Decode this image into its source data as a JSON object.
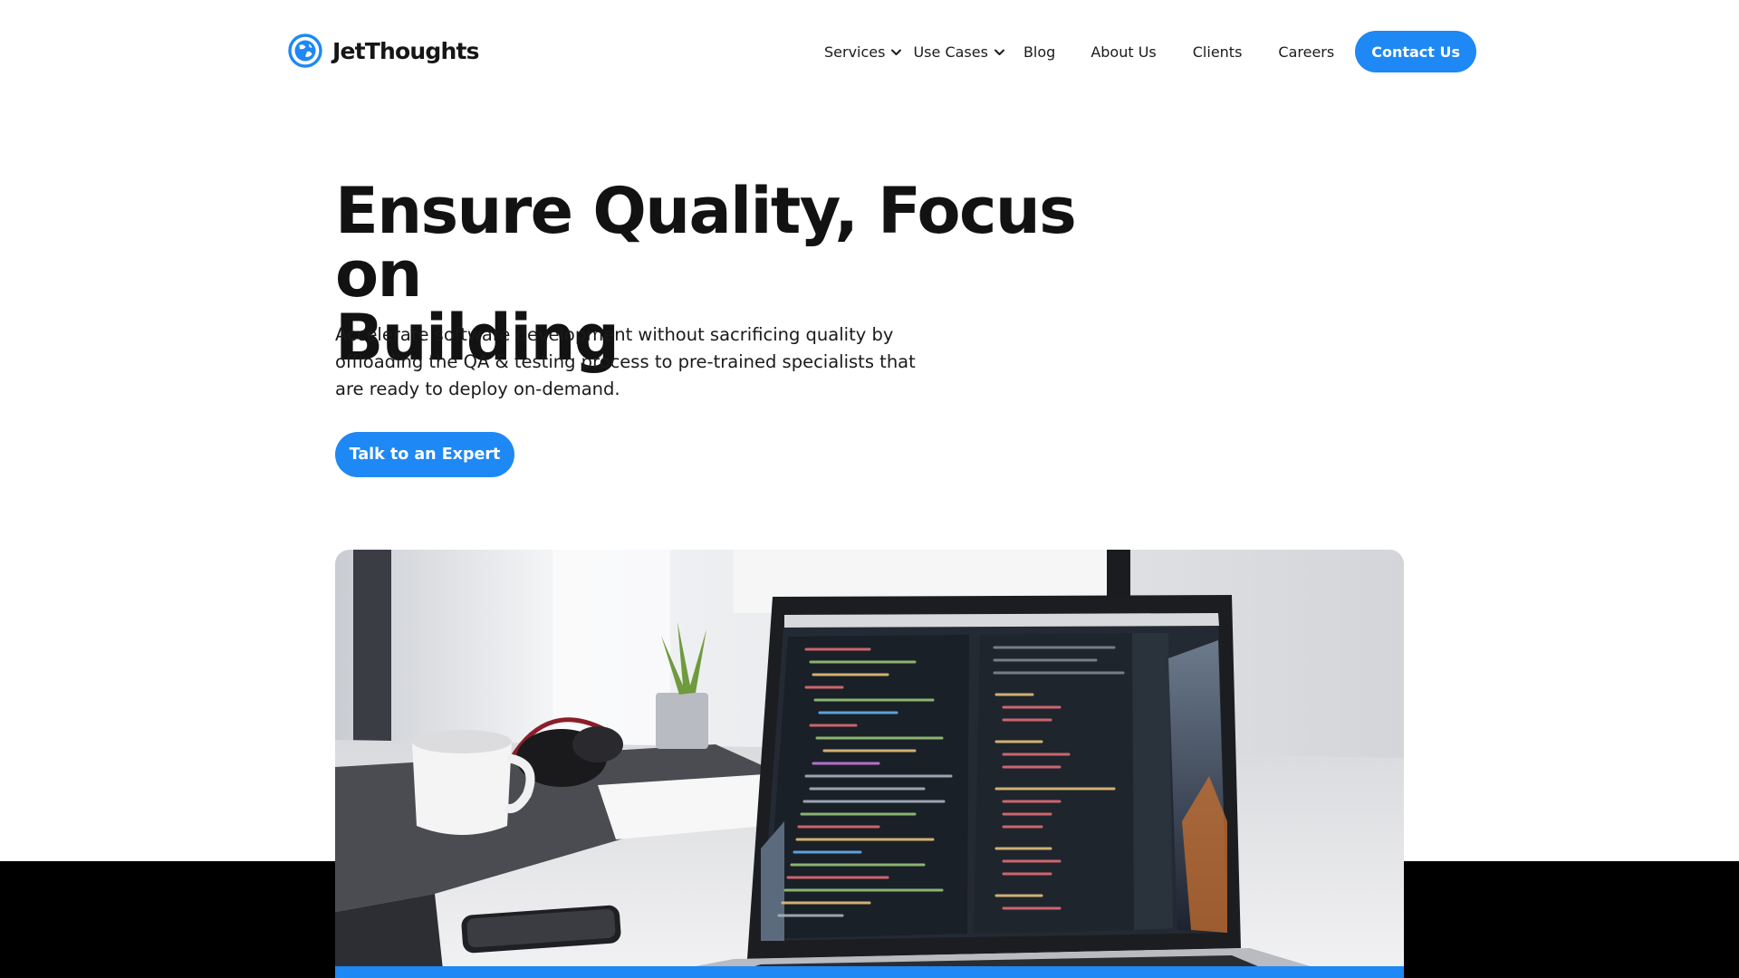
{
  "brand": {
    "name": "JetThoughts",
    "logo_icon": "globe-logo-icon",
    "accent_color": "#1e88f5"
  },
  "nav": {
    "items": [
      {
        "label": "Services",
        "has_dropdown": true
      },
      {
        "label": "Use Cases",
        "has_dropdown": true
      },
      {
        "label": "Blog"
      },
      {
        "label": "About Us"
      },
      {
        "label": "Clients"
      },
      {
        "label": "Careers"
      }
    ],
    "contact_label": "Contact Us"
  },
  "hero": {
    "title_line1": "Ensure Quality, Focus on",
    "title_line2": "Building",
    "subtitle": "Accelerate software development without sacrificing quality by offloading the QA & testing process to pre-trained specialists that are ready to deploy on-demand.",
    "cta_label": "Talk to an Expert"
  },
  "image": {
    "subject": "laptop-with-code-photo"
  }
}
